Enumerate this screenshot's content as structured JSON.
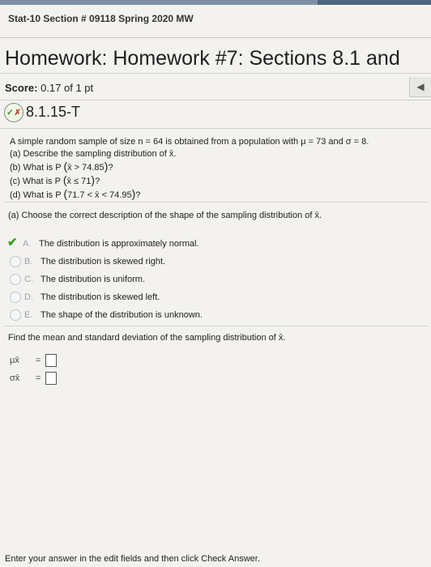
{
  "course": "Stat-10 Section # 09118 Spring 2020 MW",
  "title": "Homework: Homework #7: Sections 8.1 and",
  "score": {
    "label": "Score:",
    "value": "0.17 of 1 pt"
  },
  "question_number": "8.1.15-T",
  "problem": {
    "intro": "A simple random sample of size n = 64 is obtained from a population with μ = 73 and σ = 8.",
    "a": "(a) Describe the sampling distribution of x̄.",
    "b_prefix": "(b) What is P",
    "b_expr": "x̄ > 74.85",
    "c_prefix": "(c) What is P",
    "c_expr": "x̄ ≤ 71",
    "d_prefix": "(d) What is P",
    "d_expr": "71.7 < x̄ < 74.95",
    "q": "?"
  },
  "part_a_prompt": "(a) Choose the correct description of the shape of the sampling distribution of x̄.",
  "choices": [
    {
      "letter": "A.",
      "text": "The distribution is approximately normal."
    },
    {
      "letter": "B.",
      "text": "The distribution is skewed right."
    },
    {
      "letter": "C.",
      "text": "The distribution is uniform."
    },
    {
      "letter": "D.",
      "text": "The distribution is skewed left."
    },
    {
      "letter": "E.",
      "text": "The shape of the distribution is unknown."
    }
  ],
  "find_prompt": "Find the mean and standard deviation of the sampling distribution of x̄.",
  "mean_symbol": "μx̄",
  "sd_symbol": "σx̄",
  "equals": "=",
  "footer": "Enter your answer in the edit fields and then click Check Answer."
}
